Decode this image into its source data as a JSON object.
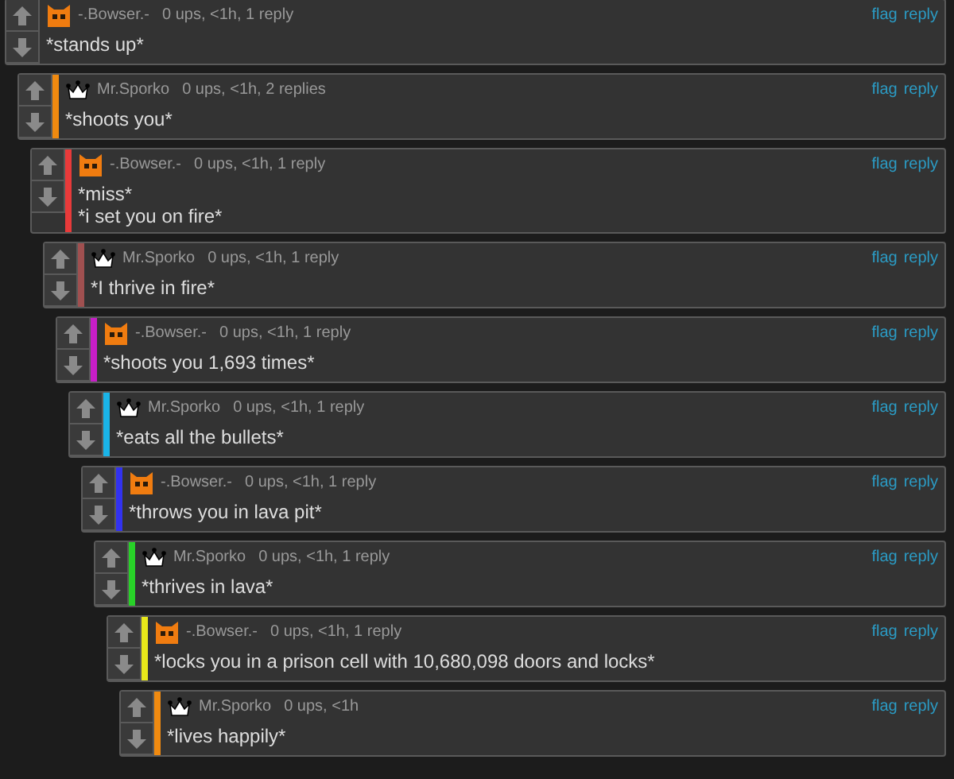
{
  "comments": [
    {
      "author": "-.Bowser.-",
      "kind": "cat",
      "meta": "0 ups, <1h, 1 reply",
      "text": "*stands up*",
      "actions": [
        "flag",
        "reply"
      ],
      "children": [
        {
          "author": "Mr.Sporko",
          "kind": "crown",
          "color": "#f08a10",
          "meta": "0 ups, <1h, 2 replies",
          "text": "*shoots you*",
          "actions": [
            "flag",
            "reply"
          ],
          "children": [
            {
              "author": "-.Bowser.-",
              "kind": "cat",
              "color": "#e83a3a",
              "meta": "0 ups, <1h, 1 reply",
              "text": "*miss*\n*i set you on fire*",
              "actions": [
                "flag",
                "reply"
              ],
              "children": [
                {
                  "author": "Mr.Sporko",
                  "kind": "crown",
                  "color": "#a05050",
                  "meta": "0 ups, <1h, 1 reply",
                  "text": "*I thrive in fire*",
                  "actions": [
                    "flag",
                    "reply"
                  ],
                  "children": [
                    {
                      "author": "-.Bowser.-",
                      "kind": "cat",
                      "color": "#c81ec8",
                      "meta": "0 ups, <1h, 1 reply",
                      "text": "*shoots you 1,693 times*",
                      "actions": [
                        "flag",
                        "reply"
                      ],
                      "children": [
                        {
                          "author": "Mr.Sporko",
                          "kind": "crown",
                          "color": "#1ab4e8",
                          "meta": "0 ups, <1h, 1 reply",
                          "text": "*eats all the bullets*",
                          "actions": [
                            "flag",
                            "reply"
                          ],
                          "children": [
                            {
                              "author": "-.Bowser.-",
                              "kind": "cat",
                              "color": "#3232f0",
                              "meta": "0 ups, <1h, 1 reply",
                              "text": "*throws you in lava pit*",
                              "actions": [
                                "flag",
                                "reply"
                              ],
                              "children": [
                                {
                                  "author": "Mr.Sporko",
                                  "kind": "crown",
                                  "color": "#28d228",
                                  "meta": "0 ups, <1h, 1 reply",
                                  "text": "*thrives in lava*",
                                  "actions": [
                                    "flag",
                                    "reply"
                                  ],
                                  "children": [
                                    {
                                      "author": "-.Bowser.-",
                                      "kind": "cat",
                                      "color": "#e8e81a",
                                      "meta": "0 ups, <1h, 1 reply",
                                      "text": "*locks you in a prison cell with 10,680,098 doors and locks*",
                                      "actions": [
                                        "flag",
                                        "reply"
                                      ],
                                      "children": [
                                        {
                                          "author": "Mr.Sporko",
                                          "kind": "crown",
                                          "color": "#f08a10",
                                          "meta": "0 ups, <1h",
                                          "text": "*lives happily*",
                                          "actions": [
                                            "flag",
                                            "reply"
                                          ]
                                        }
                                      ]
                                    }
                                  ]
                                }
                              ]
                            }
                          ]
                        }
                      ]
                    }
                  ]
                }
              ]
            }
          ]
        }
      ]
    }
  ]
}
